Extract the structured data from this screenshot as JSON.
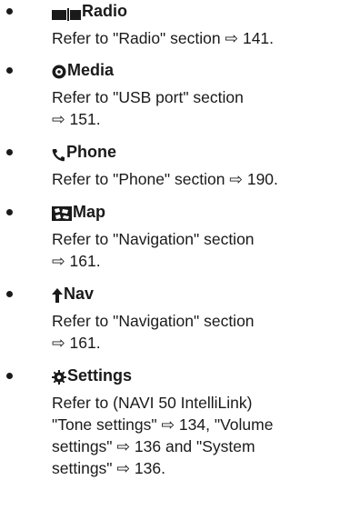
{
  "items": [
    {
      "title": "Radio",
      "icon": "radio-icon",
      "text": "Refer to \"Radio\" section ⇨ 141."
    },
    {
      "title": "Media",
      "icon": "media-icon",
      "text": "Refer to \"USB port\" section\n⇨ 151."
    },
    {
      "title": "Phone",
      "icon": "phone-icon",
      "text": "Refer to \"Phone\" section ⇨ 190."
    },
    {
      "title": "Map",
      "icon": "map-icon",
      "text": "Refer to \"Navigation\" section\n⇨ 161."
    },
    {
      "title": "Nav",
      "icon": "nav-icon",
      "text": "Refer to \"Navigation\" section\n⇨ 161."
    },
    {
      "title": "Settings",
      "icon": "settings-icon",
      "text": "Refer to (NAVI 50 IntelliLink)\n\"Tone settings\" ⇨ 134, \"Volume\nsettings\" ⇨ 136 and \"System\nsettings\" ⇨ 136."
    }
  ]
}
